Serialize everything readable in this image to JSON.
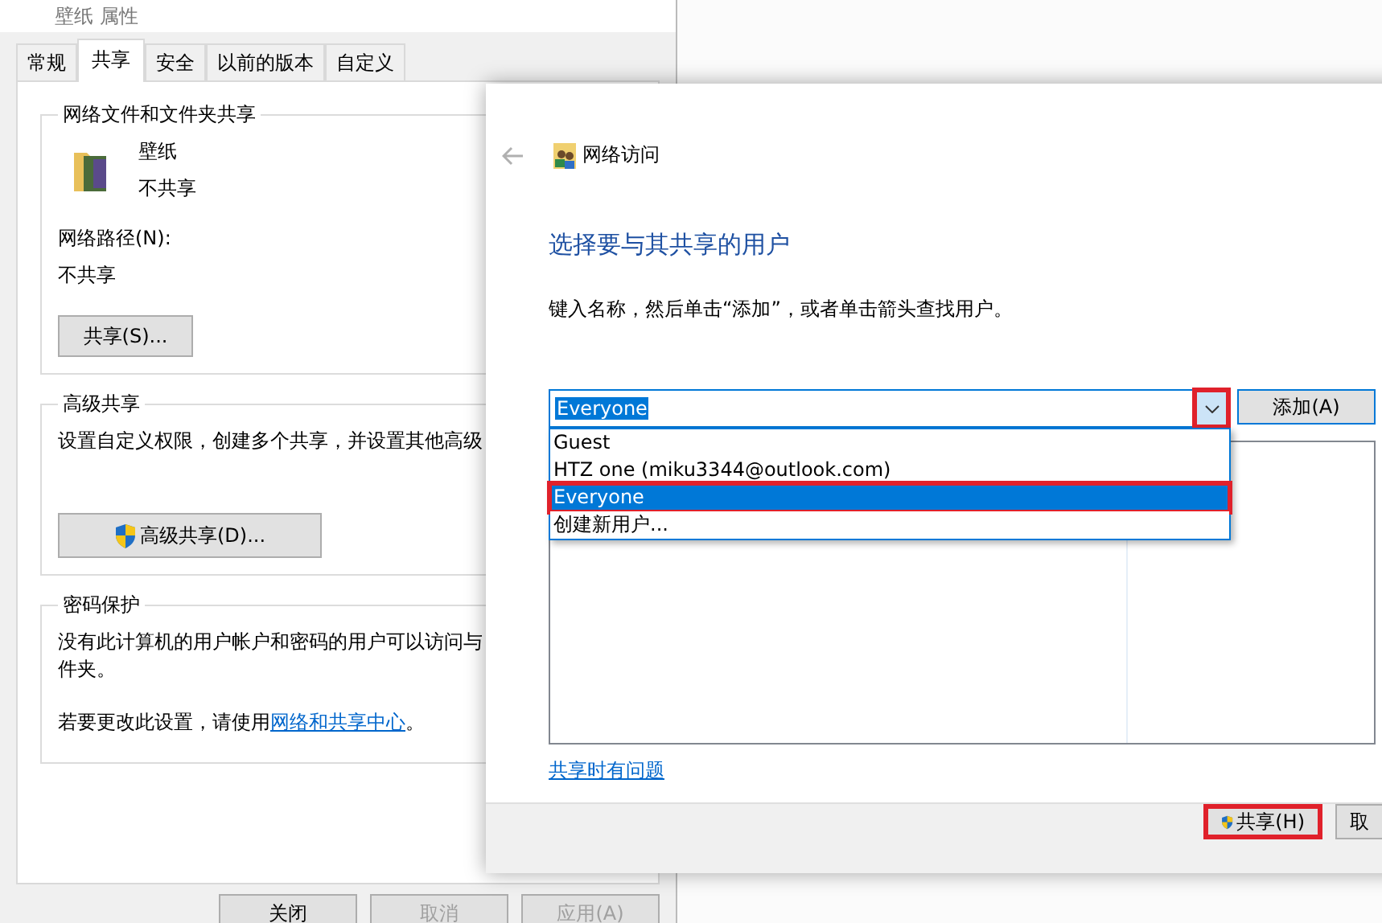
{
  "properties_window": {
    "title": "壁纸 属性",
    "tabs": [
      {
        "label": "常规",
        "selected": false
      },
      {
        "label": "共享",
        "selected": true
      },
      {
        "label": "安全",
        "selected": false
      },
      {
        "label": "以前的版本",
        "selected": false
      },
      {
        "label": "自定义",
        "selected": false
      }
    ],
    "network_sharing": {
      "heading": "网络文件和文件夹共享",
      "folder_name": "壁纸",
      "folder_status": "不共享",
      "path_label": "网络路径(N):",
      "path_value": "不共享",
      "button": "共享(S)..."
    },
    "advanced_sharing": {
      "heading": "高级共享",
      "description": "设置自定义权限，创建多个共享，并设置其他高级",
      "button": "高级共享(D)..."
    },
    "password_protection": {
      "heading": "密码保护",
      "description_lines": [
        "没有此计算机的用户帐户和密码的用户可以访问与",
        "件夹。"
      ],
      "change_prefix": "若要更改此设置，请使用",
      "change_link": "网络和共享中心",
      "change_suffix": "。"
    },
    "buttons": [
      {
        "label": "关闭",
        "disabled": false
      },
      {
        "label": "取消",
        "disabled": true
      },
      {
        "label": "应用(A)",
        "disabled": true
      }
    ]
  },
  "network_access_dialog": {
    "title": "网络访问",
    "back_disabled": true,
    "heading": "选择要与其共享的用户",
    "instruction": "键入名称，然后单击“添加”，或者单击箭头查找用户。",
    "combo_value": "Everyone",
    "combo_arrow_highlighted": true,
    "add_button": "添加(A)",
    "dropdown_items": [
      {
        "label": "Guest",
        "selected": false,
        "highlighted": false
      },
      {
        "label": "HTZ one (miku3344@outlook.com)",
        "selected": false,
        "highlighted": false
      },
      {
        "label": "Everyone",
        "selected": true,
        "highlighted": true
      },
      {
        "label": "创建新用户...",
        "selected": false,
        "highlighted": false
      }
    ],
    "help_link": "共享时有问题",
    "footer_buttons": [
      {
        "label": "共享(H)",
        "kind": "shield",
        "highlighted": true
      },
      {
        "label": "取",
        "kind": "plain",
        "highlighted": false
      }
    ]
  }
}
